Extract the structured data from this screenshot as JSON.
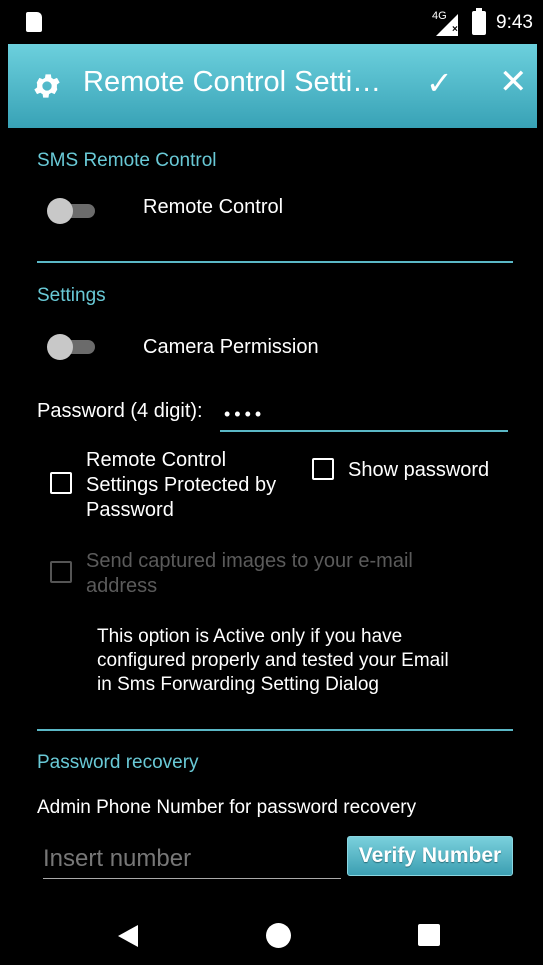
{
  "status_bar": {
    "network": "4G",
    "time": "9:43"
  },
  "toolbar": {
    "title": "Remote Control Setti…",
    "check_icon": "check-icon",
    "close_icon": "close-icon",
    "accent": "#4fb6c6"
  },
  "sms_section": {
    "header": "SMS Remote Control",
    "remote_control": {
      "label": "Remote Control",
      "on": false
    }
  },
  "settings_section": {
    "header": "Settings",
    "camera_permission": {
      "label": "Camera Permission",
      "on": false
    },
    "password_label": "Password (4 digit):",
    "password_value": "••••",
    "protected_checkbox": {
      "label_line1": "Remote Control",
      "label_line2": "Settings Protected by",
      "label_line3": "Password",
      "checked": false
    },
    "show_password": {
      "label": "Show password",
      "checked": false
    },
    "send_images": {
      "label_line1": "Send captured images to your e-mail",
      "label_line2": "address",
      "checked": false,
      "enabled": false
    },
    "note_line1": "This option is Active only if you have",
    "note_line2": "configured properly and tested your Email",
    "note_line3": "in Sms Forwarding Setting Dialog"
  },
  "recovery_section": {
    "header": "Password recovery",
    "admin_label": "Admin Phone Number for password recovery",
    "number_placeholder": "Insert number",
    "verify_label": "Verify Number"
  }
}
